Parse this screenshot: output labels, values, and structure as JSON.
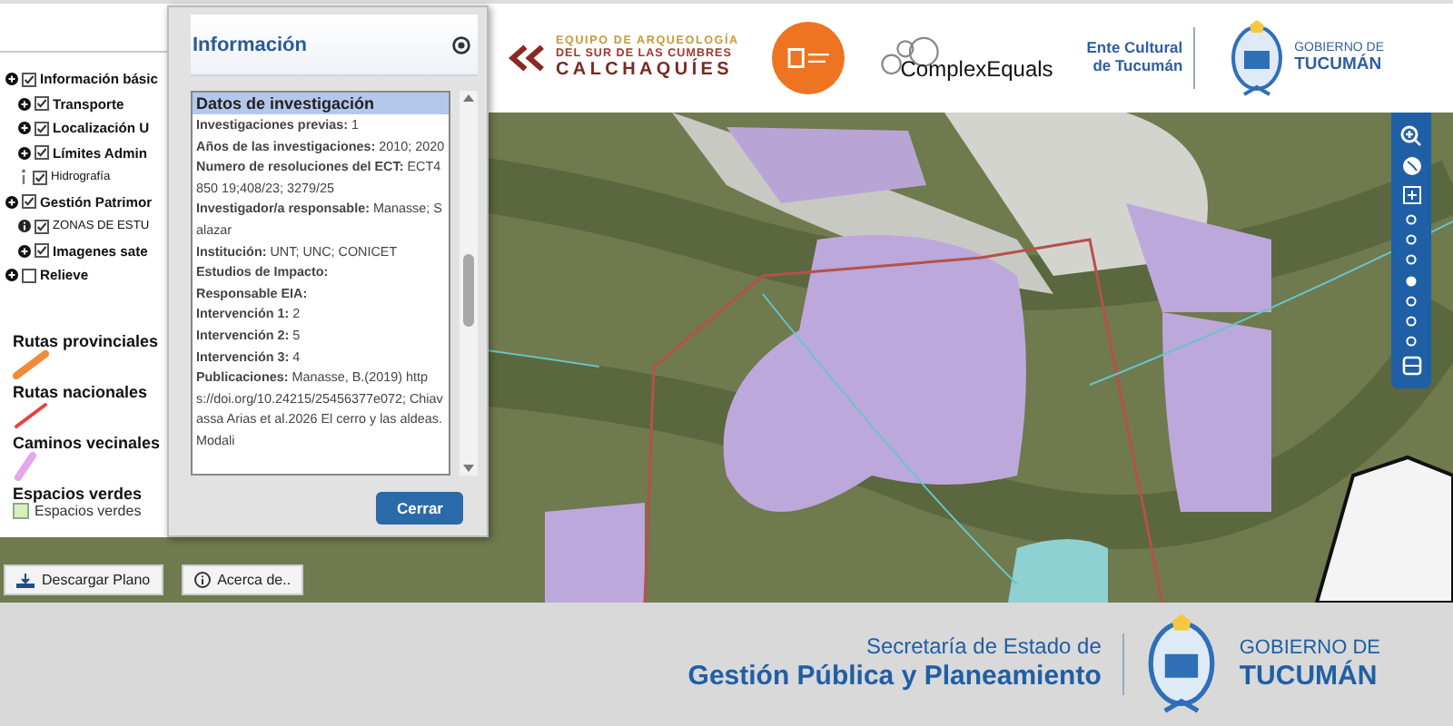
{
  "header": {
    "logos": [
      {
        "kind": "arqueologia",
        "lines": [
          "EQUIPO DE ARQUEOLOGÍA",
          "DEL SUR DE LAS CUMBRES",
          "CALCHAQUÍES"
        ]
      },
      {
        "kind": "unc"
      },
      {
        "kind": "complex",
        "lines": [
          "ComplexEquals"
        ]
      },
      {
        "kind": "ente",
        "lines": [
          "Ente Cultural",
          "de Tucumán"
        ]
      },
      {
        "kind": "gobierno",
        "lines": [
          "GOBIERNO DE",
          "TUCUMÁN"
        ]
      }
    ]
  },
  "layers": [
    {
      "label": "Información básic",
      "kind": "group",
      "checked": true,
      "children": [
        {
          "label": "Transporte",
          "kind": "group",
          "checked": true
        },
        {
          "label": "Localización U",
          "kind": "group",
          "checked": true
        },
        {
          "label": "Límites Admin",
          "kind": "group",
          "checked": true
        },
        {
          "label": "Hidrografía",
          "kind": "info",
          "checked": true
        }
      ]
    },
    {
      "label": "Gestión Patrimor",
      "kind": "group",
      "checked": true,
      "children": [
        {
          "label": "ZONAS DE ESTU",
          "kind": "info-circle",
          "checked": true
        },
        {
          "label": "Imagenes sate",
          "kind": "group",
          "checked": true
        }
      ]
    },
    {
      "label": "Relieve",
      "kind": "group",
      "checked": false
    }
  ],
  "legend": [
    {
      "title": "Rutas provinciales",
      "kind": "line",
      "color": "#f28a3a"
    },
    {
      "title": "Rutas nacionales",
      "kind": "line",
      "color": "#e8403a"
    },
    {
      "title": "Caminos vecinales",
      "kind": "outline",
      "color": "#e6a6ea"
    },
    {
      "title": "Espacios verdes",
      "kind": "box",
      "color": "#d7f0c0",
      "label": "Espacios verdes"
    }
  ],
  "popup": {
    "title": "Información",
    "section": "Datos de investigación",
    "fields": [
      {
        "label": "Investigaciones previas:",
        "value": "1"
      },
      {
        "label": "Años de las investigaciones:",
        "value": "2010; 2020"
      },
      {
        "label": "Numero de resoluciones del ECT:",
        "value": "ECT4850 19;408/23; 3279/25"
      },
      {
        "label": "Investigador/a responsable:",
        "value": "Manasse; Salazar"
      },
      {
        "label": "Institución:",
        "value": "UNT; UNC; CONICET"
      },
      {
        "label": "Estudios de Impacto:"
      },
      {
        "label": "Responsable EIA:"
      },
      {
        "label": "Intervención 1:",
        "value": "2"
      },
      {
        "label": "Intervención 2:",
        "value": "5"
      },
      {
        "label": "Intervención 3:",
        "value": "4"
      },
      {
        "label": "Publicaciones:",
        "value": "Manasse, B.(2019) https://doi.org/10.24215/25456377e072; Chiavassa Arias et al.2026 El cerro y las aldeas. Modali"
      }
    ],
    "button": "Cerrar"
  },
  "map_buttons": [
    {
      "label": "Descargar Plano",
      "kind": "download"
    },
    {
      "label": "Acerca de..",
      "kind": "info"
    }
  ],
  "footer": {
    "line1": "Secretaría de Estado de",
    "line2": "Gestión Pública y Planeamiento",
    "gov1": "GOBIERNO DE",
    "gov2": "TUCUMÁN"
  }
}
